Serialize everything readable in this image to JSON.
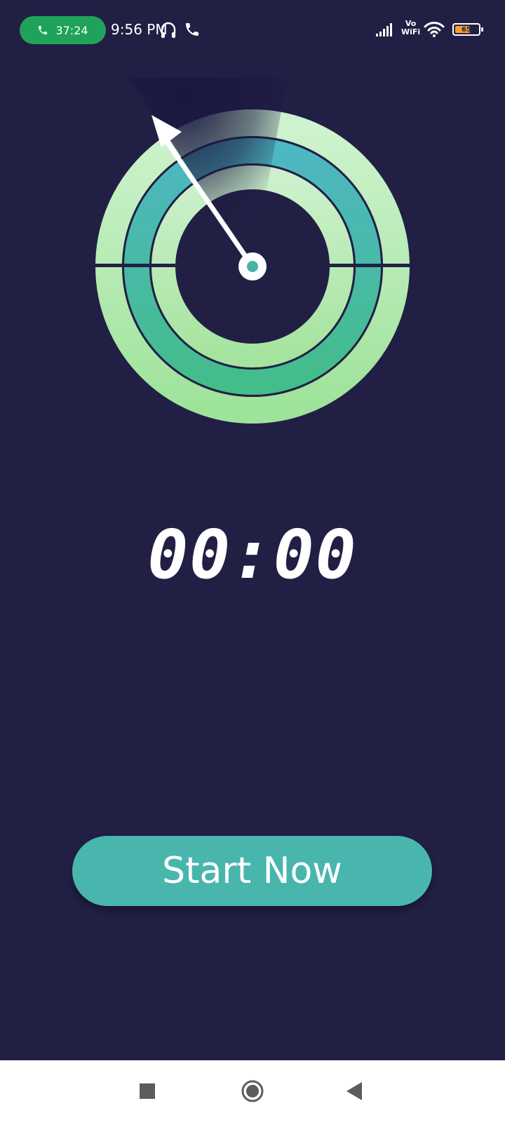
{
  "status_bar": {
    "call_timer": "37:24",
    "time": "9:56 PM",
    "vowifi_top": "Vo",
    "vowifi_bottom": "WiFi",
    "battery_level": "65",
    "battery_fraction": 0.65
  },
  "gauge": {
    "needle_icon": "arrow-needle",
    "colors": {
      "outer_ring": "#b6eab9",
      "middle_ring": "#47b4a4",
      "inner_ring": "#b7eab6",
      "background": "#221f45"
    }
  },
  "timer": {
    "value": "00:00"
  },
  "actions": {
    "start_label": "Start Now"
  },
  "navbar": {
    "recents_icon": "square-icon",
    "home_icon": "circle-icon",
    "back_icon": "triangle-back-icon"
  }
}
